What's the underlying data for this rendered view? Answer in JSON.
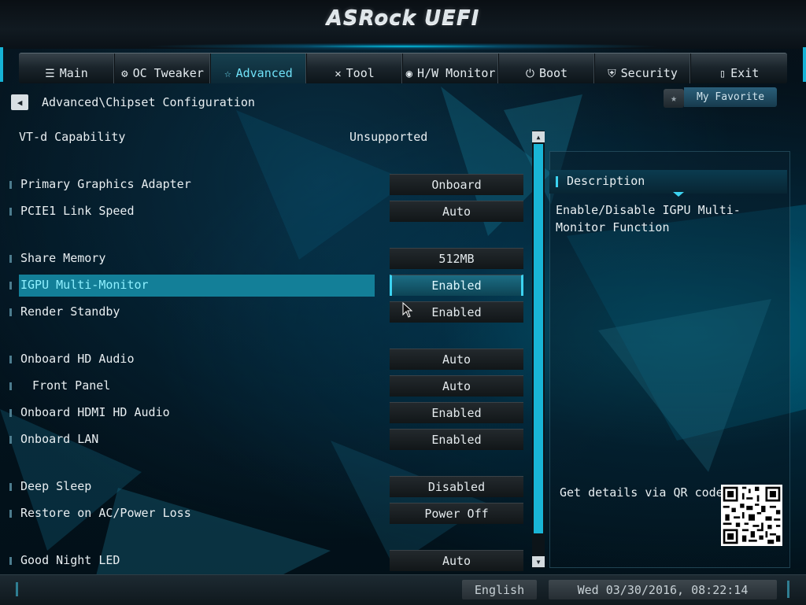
{
  "header": {
    "logo": "ASRock UEFI"
  },
  "tabs": [
    {
      "label": "Main",
      "icon": "list-icon",
      "glyph": "☰"
    },
    {
      "label": "OC Tweaker",
      "icon": "rocket-icon",
      "glyph": "⚙"
    },
    {
      "label": "Advanced",
      "icon": "star-icon",
      "glyph": "☆"
    },
    {
      "label": "Tool",
      "icon": "tools-icon",
      "glyph": "✕"
    },
    {
      "label": "H/W Monitor",
      "icon": "monitor-icon",
      "glyph": "◉"
    },
    {
      "label": "Boot",
      "icon": "power-icon",
      "glyph": "⏻"
    },
    {
      "label": "Security",
      "icon": "shield-icon",
      "glyph": "⛨"
    },
    {
      "label": "Exit",
      "icon": "door-icon",
      "glyph": "▯"
    }
  ],
  "active_tab": "Advanced",
  "breadcrumb": "Advanced\\Chipset Configuration",
  "favorite": {
    "label": "My Favorite"
  },
  "info": {
    "label": "VT-d Capability",
    "value": "Unsupported"
  },
  "settings": [
    {
      "label": "Primary Graphics Adapter",
      "value": "Onboard"
    },
    {
      "label": "PCIE1 Link Speed",
      "value": "Auto"
    },
    {
      "label": "Share Memory",
      "value": "512MB"
    },
    {
      "label": "IGPU Multi-Monitor",
      "value": "Enabled",
      "selected": true
    },
    {
      "label": "Render Standby",
      "value": "Enabled"
    },
    {
      "label": "Onboard HD Audio",
      "value": "Auto"
    },
    {
      "label": "Front Panel",
      "value": "Auto",
      "indent": true
    },
    {
      "label": "Onboard HDMI HD Audio",
      "value": "Enabled"
    },
    {
      "label": "Onboard LAN",
      "value": "Enabled"
    },
    {
      "label": "Deep Sleep",
      "value": "Disabled"
    },
    {
      "label": "Restore on AC/Power Loss",
      "value": "Power Off"
    },
    {
      "label": "Good Night LED",
      "value": "Auto"
    }
  ],
  "description": {
    "title": "Description",
    "text": "Enable/Disable IGPU Multi-Monitor Function",
    "qr_label": "Get details via QR code"
  },
  "footer": {
    "language": "English",
    "datetime": "Wed 03/30/2016, 08:22:14"
  },
  "colors": {
    "accent": "#19b5d6",
    "selection": "#137f98"
  }
}
